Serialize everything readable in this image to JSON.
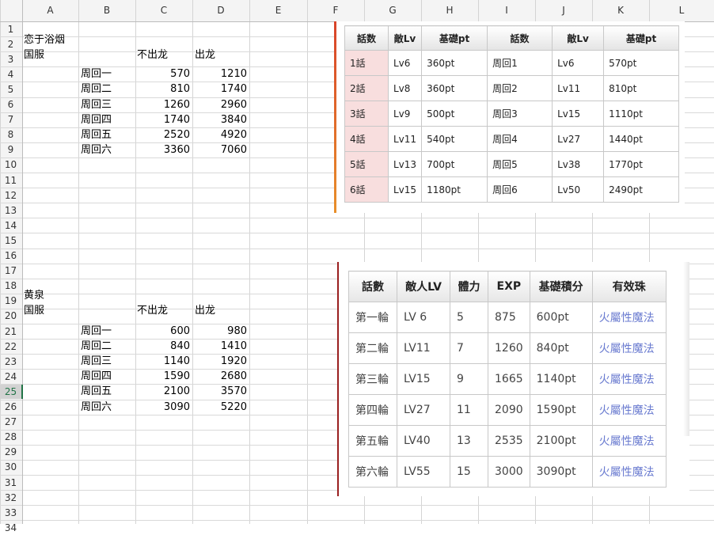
{
  "sheet": {
    "columns": [
      "A",
      "B",
      "C",
      "D",
      "E",
      "F",
      "G",
      "H",
      "I",
      "J",
      "K",
      "L"
    ],
    "rows": [
      "1",
      "2",
      "3",
      "4",
      "5",
      "6",
      "7",
      "8",
      "9",
      "10",
      "11",
      "12",
      "13",
      "14",
      "15",
      "16",
      "17",
      "18",
      "19",
      "20",
      "21",
      "22",
      "23",
      "24",
      "25",
      "26",
      "27",
      "28",
      "29",
      "30",
      "31",
      "32",
      "33",
      "34"
    ],
    "selected_row": "25",
    "block1": {
      "title": "恋于浴烟",
      "label": "国服",
      "col_no_dragon": "不出龙",
      "col_dragon": "出龙",
      "rows": [
        {
          "name": "周回一",
          "no": "570",
          "yes": "1210"
        },
        {
          "name": "周回二",
          "no": "810",
          "yes": "1740"
        },
        {
          "name": "周回三",
          "no": "1260",
          "yes": "2960"
        },
        {
          "name": "周回四",
          "no": "1740",
          "yes": "3840"
        },
        {
          "name": "周回五",
          "no": "2520",
          "yes": "4920"
        },
        {
          "name": "周回六",
          "no": "3360",
          "yes": "7060"
        }
      ]
    },
    "block2": {
      "title": "黄泉",
      "label": "国服",
      "col_no_dragon": "不出龙",
      "col_dragon": "出龙",
      "rows": [
        {
          "name": "周回一",
          "no": "600",
          "yes": "980"
        },
        {
          "name": "周回二",
          "no": "840",
          "yes": "1410"
        },
        {
          "name": "周回三",
          "no": "1140",
          "yes": "1920"
        },
        {
          "name": "周回四",
          "no": "1590",
          "yes": "2680"
        },
        {
          "name": "周回五",
          "no": "2100",
          "yes": "3570"
        },
        {
          "name": "周回六",
          "no": "3090",
          "yes": "5220"
        }
      ]
    }
  },
  "table1": {
    "headers": [
      "話数",
      "敵Lv",
      "基礎pt",
      "話数",
      "敵Lv",
      "基礎pt"
    ],
    "rows": [
      [
        "1話",
        "Lv6",
        "360pt",
        "周回1",
        "Lv6",
        "570pt"
      ],
      [
        "2話",
        "Lv8",
        "360pt",
        "周回2",
        "Lv11",
        "810pt"
      ],
      [
        "3話",
        "Lv9",
        "500pt",
        "周回3",
        "Lv15",
        "1110pt"
      ],
      [
        "4話",
        "Lv11",
        "540pt",
        "周回4",
        "Lv27",
        "1440pt"
      ],
      [
        "5話",
        "Lv13",
        "700pt",
        "周回5",
        "Lv38",
        "1770pt"
      ],
      [
        "6話",
        "Lv15",
        "1180pt",
        "周回6",
        "Lv50",
        "2490pt"
      ]
    ]
  },
  "table2": {
    "headers": [
      "話數",
      "敵人LV",
      "體力",
      "EXP",
      "基礎積分",
      "有效珠"
    ],
    "rows": [
      [
        "第一輪",
        "LV 6",
        "5",
        "875",
        "600pt",
        "火屬性魔法"
      ],
      [
        "第二輪",
        "LV11",
        "7",
        "1260",
        "840pt",
        "火屬性魔法"
      ],
      [
        "第三輪",
        "LV15",
        "9",
        "1665",
        "1140pt",
        "火屬性魔法"
      ],
      [
        "第四輪",
        "LV27",
        "11",
        "2090",
        "1590pt",
        "火屬性魔法"
      ],
      [
        "第五輪",
        "LV40",
        "13",
        "2535",
        "2100pt",
        "火屬性魔法"
      ],
      [
        "第六輪",
        "LV55",
        "15",
        "3000",
        "3090pt",
        "火屬性魔法"
      ]
    ]
  }
}
